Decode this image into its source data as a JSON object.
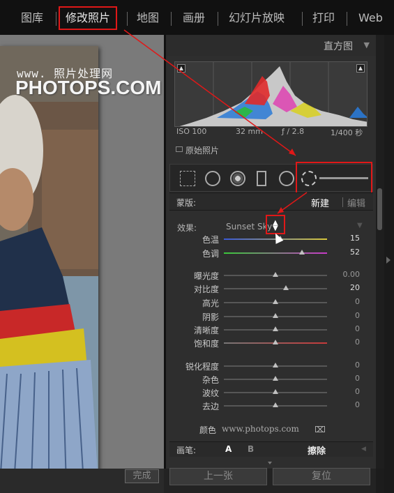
{
  "modules": {
    "library": "图库",
    "develop": "修改照片",
    "map": "地图",
    "book": "画册",
    "slideshow": "幻灯片放映",
    "print": "打印",
    "web": "Web"
  },
  "watermark": {
    "line1": "www.   照片处理网",
    "line2": "PHOTOPS.COM"
  },
  "histogram": {
    "title": "直方图",
    "iso": "ISO 100",
    "focal": "32 mm",
    "aperture": "ƒ / 2.8",
    "shutter": "1/400 秒",
    "original_label": "原始照片"
  },
  "mask": {
    "label": "蒙版:",
    "new": "新建",
    "edit": "编辑"
  },
  "effect": {
    "label": "效果:",
    "value": "Sunset Sky"
  },
  "sliders": {
    "temp": {
      "label": "色温",
      "value": "15",
      "level": 0.55
    },
    "tint": {
      "label": "色调",
      "value": "52",
      "level": 0.76
    },
    "exposure": {
      "label": "曝光度",
      "value": "0.00",
      "level": 0.5
    },
    "contrast": {
      "label": "对比度",
      "value": "20",
      "level": 0.6
    },
    "highlights": {
      "label": "高光",
      "value": "0",
      "level": 0.5
    },
    "shadows": {
      "label": "阴影",
      "value": "0",
      "level": 0.5
    },
    "clarity": {
      "label": "清晰度",
      "value": "0",
      "level": 0.5
    },
    "saturation": {
      "label": "饱和度",
      "value": "0",
      "level": 0.5
    },
    "sharpness": {
      "label": "锐化程度",
      "value": "0",
      "level": 0.5
    },
    "noise": {
      "label": "杂色",
      "value": "0",
      "level": 0.5
    },
    "moire": {
      "label": "波纹",
      "value": "0",
      "level": 0.5
    },
    "defringe": {
      "label": "去边",
      "value": "0",
      "level": 0.5
    }
  },
  "color": {
    "label": "颜色",
    "url": "www.photops.com"
  },
  "brush": {
    "label": "画笔:",
    "a": "A",
    "b": "B",
    "erase": "擦除"
  },
  "buttons": {
    "done": "完成",
    "previous": "上一张",
    "reset": "复位"
  },
  "colors": {
    "accent_red": "#e01818"
  }
}
